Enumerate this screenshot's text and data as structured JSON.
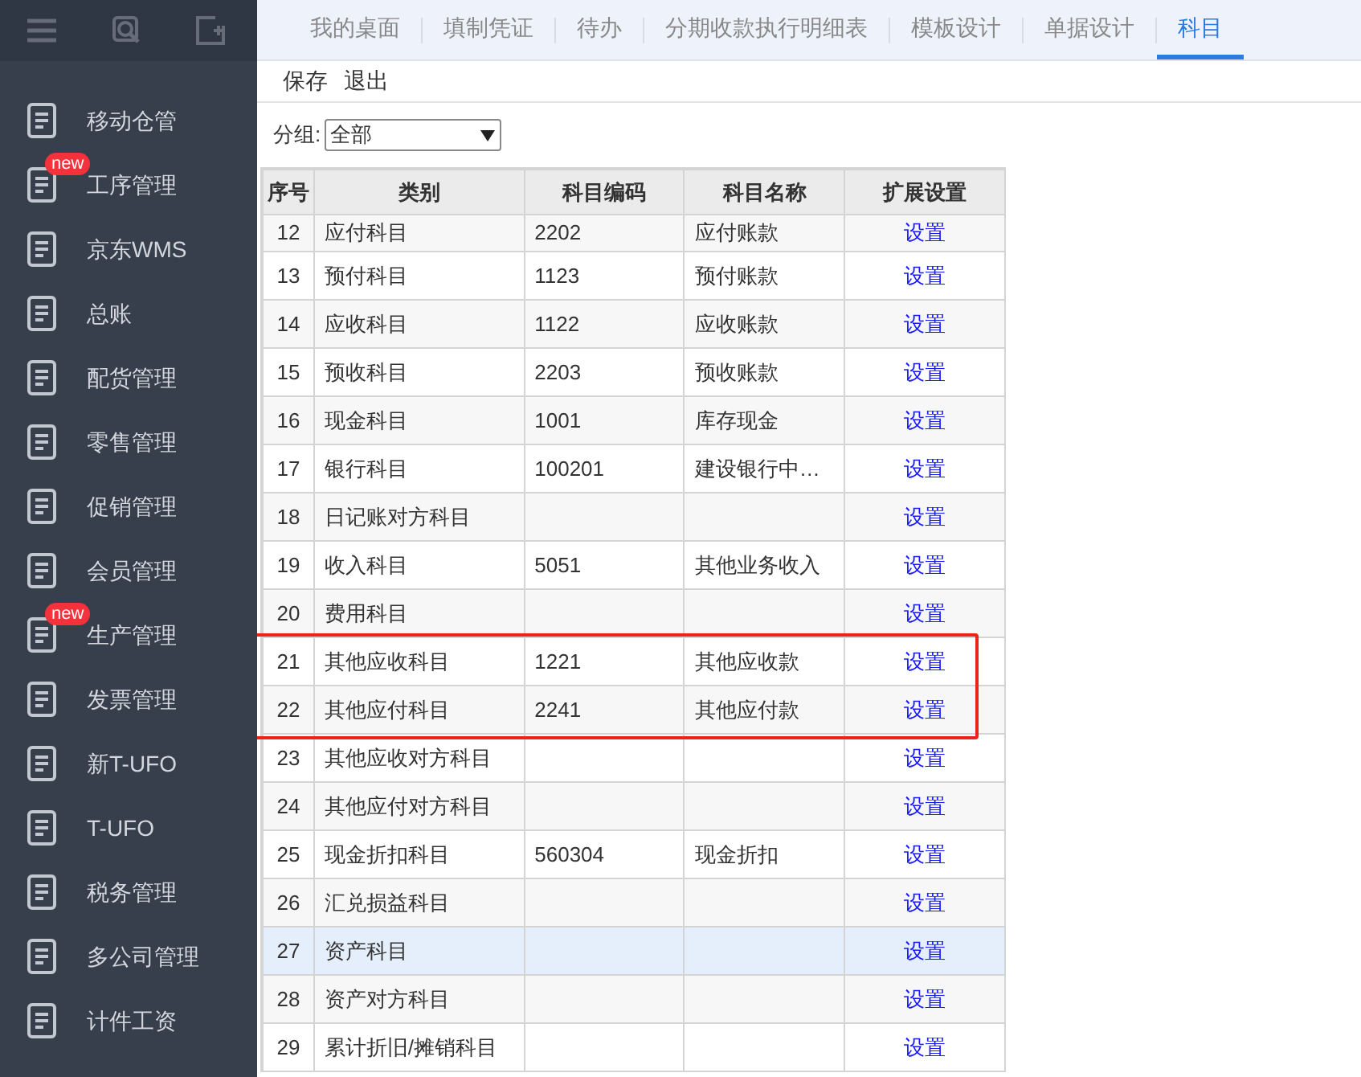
{
  "sidebar": {
    "items": [
      {
        "label": "移动仓管"
      },
      {
        "label": "工序管理",
        "badge": "new"
      },
      {
        "label": "京东WMS"
      },
      {
        "label": "总账"
      },
      {
        "label": "配货管理"
      },
      {
        "label": "零售管理"
      },
      {
        "label": "促销管理"
      },
      {
        "label": "会员管理"
      },
      {
        "label": "生产管理",
        "badge": "new"
      },
      {
        "label": "发票管理"
      },
      {
        "label": "新T-UFO"
      },
      {
        "label": "T-UFO"
      },
      {
        "label": "税务管理"
      },
      {
        "label": "多公司管理"
      },
      {
        "label": "计件工资"
      }
    ]
  },
  "tabs": [
    {
      "label": "我的桌面",
      "selected": false
    },
    {
      "label": "填制凭证",
      "selected": false
    },
    {
      "label": "待办",
      "selected": false
    },
    {
      "label": "分期收款执行明细表",
      "selected": false
    },
    {
      "label": "模板设计",
      "selected": false
    },
    {
      "label": "单据设计",
      "selected": false
    },
    {
      "label": "科目",
      "selected": true
    }
  ],
  "toolbar": [
    "保存",
    "退出"
  ],
  "filter": {
    "label": "分组:",
    "value": "全部"
  },
  "table": {
    "columns": [
      "序号",
      "类别",
      "科目编码",
      "科目名称",
      "扩展设置"
    ],
    "rows": [
      {
        "no": "12",
        "category": "应付科目",
        "code": "2202",
        "name": "应付账款",
        "action": "设置",
        "selected": false
      },
      {
        "no": "13",
        "category": "预付科目",
        "code": "1123",
        "name": "预付账款",
        "action": "设置",
        "selected": false
      },
      {
        "no": "14",
        "category": "应收科目",
        "code": "1122",
        "name": "应收账款",
        "action": "设置",
        "selected": false
      },
      {
        "no": "15",
        "category": "预收科目",
        "code": "2203",
        "name": "预收账款",
        "action": "设置",
        "selected": false
      },
      {
        "no": "16",
        "category": "现金科目",
        "code": "1001",
        "name": "库存现金",
        "action": "设置",
        "selected": false
      },
      {
        "no": "17",
        "category": "银行科目",
        "code": "100201",
        "name": "建设银行中…",
        "action": "设置",
        "selected": false
      },
      {
        "no": "18",
        "category": "日记账对方科目",
        "action": "设置",
        "selected": false
      },
      {
        "no": "19",
        "category": "收入科目",
        "code": "5051",
        "name": "其他业务收入",
        "action": "设置",
        "selected": false
      },
      {
        "no": "20",
        "category": "费用科目",
        "action": "设置",
        "selected": false
      },
      {
        "no": "21",
        "category": "其他应收科目",
        "code": "1221",
        "name": "其他应收款",
        "action": "设置",
        "selected": false,
        "highlighted": true
      },
      {
        "no": "22",
        "category": "其他应付科目",
        "code": "2241",
        "name": "其他应付款",
        "action": "设置",
        "selected": false,
        "highlighted": true
      },
      {
        "no": "23",
        "category": "其他应收对方科目",
        "action": "设置",
        "selected": false
      },
      {
        "no": "24",
        "category": "其他应付对方科目",
        "action": "设置",
        "selected": false
      },
      {
        "no": "25",
        "category": "现金折扣科目",
        "code": "560304",
        "name": "现金折扣",
        "action": "设置",
        "selected": false
      },
      {
        "no": "26",
        "category": "汇兑损益科目",
        "action": "设置",
        "selected": false
      },
      {
        "no": "27",
        "category": "资产科目",
        "action": "设置",
        "selected": true
      },
      {
        "no": "28",
        "category": "资产对方科目",
        "action": "设置",
        "selected": false
      },
      {
        "no": "29",
        "category": "累计折旧/摊销科目",
        "action": "设置",
        "selected": false
      }
    ]
  }
}
